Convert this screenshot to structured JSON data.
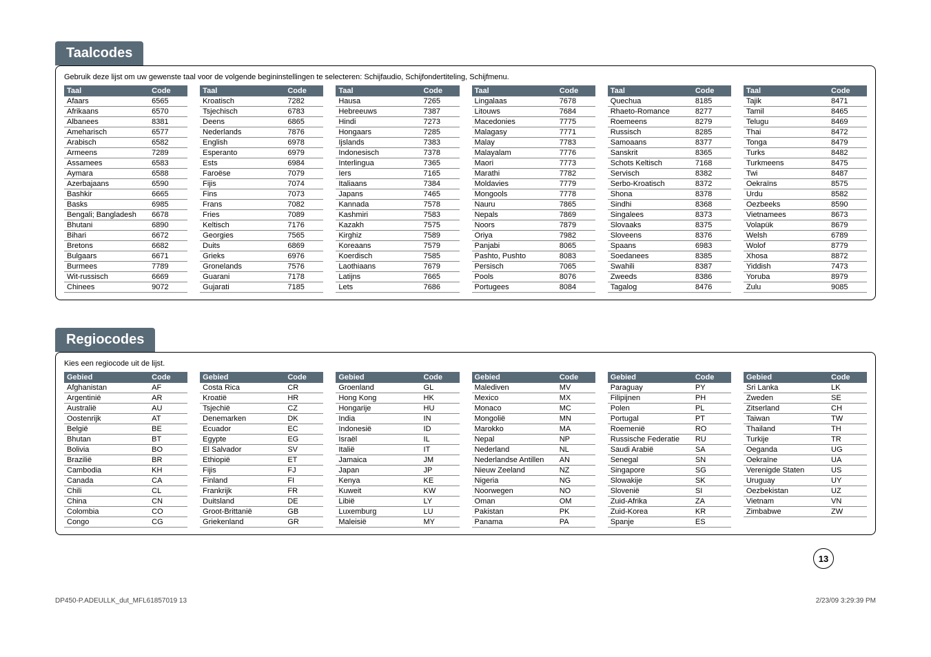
{
  "sections": {
    "taal": {
      "title": "Taalcodes",
      "intro": "Gebruik deze lijst om uw gewenste taal voor de volgende begininstellingen te selecteren: Schijfaudio, Schijfondertiteling, Schijfmenu.",
      "headers": {
        "name": "Taal",
        "code": "Code"
      },
      "columns": [
        [
          {
            "n": "Afaars",
            "c": "6565"
          },
          {
            "n": "Afrikaans",
            "c": "6570"
          },
          {
            "n": "Albanees",
            "c": "8381"
          },
          {
            "n": "Ameharisch",
            "c": "6577"
          },
          {
            "n": "Arabisch",
            "c": "6582"
          },
          {
            "n": "Armeens",
            "c": "7289"
          },
          {
            "n": "Assamees",
            "c": "6583"
          },
          {
            "n": "Aymara",
            "c": "6588"
          },
          {
            "n": "Azerbajaans",
            "c": "6590"
          },
          {
            "n": "Bashkir",
            "c": "6665"
          },
          {
            "n": "Basks",
            "c": "6985"
          },
          {
            "n": "Bengali; Bangladesh",
            "c": "6678"
          },
          {
            "n": "Bhutani",
            "c": "6890"
          },
          {
            "n": "Bihari",
            "c": "6672"
          },
          {
            "n": "Bretons",
            "c": "6682"
          },
          {
            "n": "Bulgaars",
            "c": "6671"
          },
          {
            "n": "Burmees",
            "c": "7789"
          },
          {
            "n": "Wit-russisch",
            "c": "6669"
          },
          {
            "n": "Chinees",
            "c": "9072"
          }
        ],
        [
          {
            "n": "Kroatisch",
            "c": "7282"
          },
          {
            "n": "Tsjechisch",
            "c": "6783"
          },
          {
            "n": "Deens",
            "c": "6865"
          },
          {
            "n": "Nederlands",
            "c": "7876"
          },
          {
            "n": "English",
            "c": "6978"
          },
          {
            "n": "Esperanto",
            "c": "6979"
          },
          {
            "n": "Ests",
            "c": "6984"
          },
          {
            "n": "Faroëse",
            "c": "7079"
          },
          {
            "n": "Fijis",
            "c": "7074"
          },
          {
            "n": "Fins",
            "c": "7073"
          },
          {
            "n": "Frans",
            "c": "7082"
          },
          {
            "n": "Fries",
            "c": "7089"
          },
          {
            "n": "Keltisch",
            "c": "7176"
          },
          {
            "n": "Georgies",
            "c": "7565"
          },
          {
            "n": "Duits",
            "c": "6869"
          },
          {
            "n": "Grieks",
            "c": "6976"
          },
          {
            "n": "Gronelands",
            "c": "7576"
          },
          {
            "n": "Guarani",
            "c": "7178"
          },
          {
            "n": "Gujarati",
            "c": "7185"
          }
        ],
        [
          {
            "n": "Hausa",
            "c": "7265"
          },
          {
            "n": "Hebreeuws",
            "c": "7387"
          },
          {
            "n": "Hindi",
            "c": "7273"
          },
          {
            "n": "Hongaars",
            "c": "7285"
          },
          {
            "n": "Ijslands",
            "c": "7383"
          },
          {
            "n": "Indonesisch",
            "c": "7378"
          },
          {
            "n": "Interlingua",
            "c": "7365"
          },
          {
            "n": "Iers",
            "c": "7165"
          },
          {
            "n": "Italiaans",
            "c": "7384"
          },
          {
            "n": "Japans",
            "c": "7465"
          },
          {
            "n": "Kannada",
            "c": "7578"
          },
          {
            "n": "Kashmiri",
            "c": "7583"
          },
          {
            "n": "Kazakh",
            "c": "7575"
          },
          {
            "n": "Kirghiz",
            "c": "7589"
          },
          {
            "n": "Koreaans",
            "c": "7579"
          },
          {
            "n": "Koerdisch",
            "c": "7585"
          },
          {
            "n": "Laothiaans",
            "c": "7679"
          },
          {
            "n": "Latijns",
            "c": "7665"
          },
          {
            "n": "Lets",
            "c": "7686"
          }
        ],
        [
          {
            "n": "Lingalaas",
            "c": "7678"
          },
          {
            "n": "Litouws",
            "c": "7684"
          },
          {
            "n": "Macedonies",
            "c": "7775"
          },
          {
            "n": "Malagasy",
            "c": "7771"
          },
          {
            "n": "Malay",
            "c": "7783"
          },
          {
            "n": "Malayalam",
            "c": "7776"
          },
          {
            "n": "Maori",
            "c": "7773"
          },
          {
            "n": "Marathi",
            "c": "7782"
          },
          {
            "n": "Moldavies",
            "c": "7779"
          },
          {
            "n": "Mongools",
            "c": "7778"
          },
          {
            "n": "Nauru",
            "c": "7865"
          },
          {
            "n": "Nepals",
            "c": "7869"
          },
          {
            "n": "Noors",
            "c": "7879"
          },
          {
            "n": "Oriya",
            "c": "7982"
          },
          {
            "n": "Panjabi",
            "c": "8065"
          },
          {
            "n": "Pashto, Pushto",
            "c": "8083"
          },
          {
            "n": "Persisch",
            "c": "7065"
          },
          {
            "n": "Pools",
            "c": "8076"
          },
          {
            "n": "Portugees",
            "c": "8084"
          }
        ],
        [
          {
            "n": "Quechua",
            "c": "8185"
          },
          {
            "n": "Rhaeto-Romance",
            "c": "8277"
          },
          {
            "n": "Roemeens",
            "c": "8279"
          },
          {
            "n": "Russisch",
            "c": "8285"
          },
          {
            "n": "Samoaans",
            "c": "8377"
          },
          {
            "n": "Sanskrit",
            "c": "8365"
          },
          {
            "n": "Schots Keltisch",
            "c": "7168"
          },
          {
            "n": "Servisch",
            "c": "8382"
          },
          {
            "n": "Serbo-Kroatisch",
            "c": "8372"
          },
          {
            "n": "Shona",
            "c": "8378"
          },
          {
            "n": "Sindhi",
            "c": "8368"
          },
          {
            "n": "Singalees",
            "c": "8373"
          },
          {
            "n": "Slovaaks",
            "c": "8375"
          },
          {
            "n": "Sloveens",
            "c": "8376"
          },
          {
            "n": "Spaans",
            "c": "6983"
          },
          {
            "n": "Soedanees",
            "c": "8385"
          },
          {
            "n": "Swahili",
            "c": "8387"
          },
          {
            "n": "Zweeds",
            "c": "8386"
          },
          {
            "n": "Tagalog",
            "c": "8476"
          }
        ],
        [
          {
            "n": "Tajik",
            "c": "8471"
          },
          {
            "n": "Tamil",
            "c": "8465"
          },
          {
            "n": "Telugu",
            "c": "8469"
          },
          {
            "n": "Thai",
            "c": "8472"
          },
          {
            "n": "Tonga",
            "c": "8479"
          },
          {
            "n": "Turks",
            "c": "8482"
          },
          {
            "n": "Turkmeens",
            "c": "8475"
          },
          {
            "n": "Twi",
            "c": "8487"
          },
          {
            "n": "Oekraïns",
            "c": "8575"
          },
          {
            "n": "Urdu",
            "c": "8582"
          },
          {
            "n": "Oezbeeks",
            "c": "8590"
          },
          {
            "n": "Vietnamees",
            "c": "8673"
          },
          {
            "n": "Volapük",
            "c": "8679"
          },
          {
            "n": "Welsh",
            "c": "6789"
          },
          {
            "n": "Wolof",
            "c": "8779"
          },
          {
            "n": "Xhosa",
            "c": "8872"
          },
          {
            "n": "Yiddish",
            "c": "7473"
          },
          {
            "n": "Yoruba",
            "c": "8979"
          },
          {
            "n": "Zulu",
            "c": "9085"
          }
        ]
      ]
    },
    "regio": {
      "title": "Regiocodes",
      "intro": "Kies een regiocode uit de lijst.",
      "headers": {
        "name": "Gebied",
        "code": "Code"
      },
      "columns": [
        [
          {
            "n": "Afghanistan",
            "c": "AF"
          },
          {
            "n": "Argentinië",
            "c": "AR"
          },
          {
            "n": "Australië",
            "c": "AU"
          },
          {
            "n": "Oostenrijk",
            "c": "AT"
          },
          {
            "n": "België",
            "c": "BE"
          },
          {
            "n": "Bhutan",
            "c": "BT"
          },
          {
            "n": "Bolivia",
            "c": "BO"
          },
          {
            "n": "Brazilië",
            "c": "BR"
          },
          {
            "n": "Cambodia",
            "c": "KH"
          },
          {
            "n": "Canada",
            "c": "CA"
          },
          {
            "n": "Chili",
            "c": "CL"
          },
          {
            "n": "China",
            "c": "CN"
          },
          {
            "n": "Colombia",
            "c": "CO"
          },
          {
            "n": "Congo",
            "c": "CG"
          }
        ],
        [
          {
            "n": "Costa Rica",
            "c": "CR"
          },
          {
            "n": "Kroatië",
            "c": "HR"
          },
          {
            "n": "Tsjechië",
            "c": "CZ"
          },
          {
            "n": "Denemarken",
            "c": "DK"
          },
          {
            "n": "Ecuador",
            "c": "EC"
          },
          {
            "n": "Egypte",
            "c": "EG"
          },
          {
            "n": "El Salvador",
            "c": "SV"
          },
          {
            "n": "Ethiopië",
            "c": "ET"
          },
          {
            "n": "Fijis",
            "c": "FJ"
          },
          {
            "n": "Finland",
            "c": "FI"
          },
          {
            "n": "Frankrijk",
            "c": "FR"
          },
          {
            "n": "Duitsland",
            "c": "DE"
          },
          {
            "n": "Groot-Brittanië",
            "c": "GB"
          },
          {
            "n": "Griekenland",
            "c": "GR"
          }
        ],
        [
          {
            "n": "Groenland",
            "c": "GL"
          },
          {
            "n": "Hong Kong",
            "c": "HK"
          },
          {
            "n": "Hongarije",
            "c": "HU"
          },
          {
            "n": "India",
            "c": "IN"
          },
          {
            "n": "Indonesië",
            "c": "ID"
          },
          {
            "n": "Israël",
            "c": "IL"
          },
          {
            "n": "Italië",
            "c": "IT"
          },
          {
            "n": "Jamaica",
            "c": "JM"
          },
          {
            "n": "Japan",
            "c": "JP"
          },
          {
            "n": "Kenya",
            "c": "KE"
          },
          {
            "n": "Kuweit",
            "c": "KW"
          },
          {
            "n": "Libië",
            "c": "LY"
          },
          {
            "n": "Luxemburg",
            "c": "LU"
          },
          {
            "n": "Maleisië",
            "c": "MY"
          }
        ],
        [
          {
            "n": "Malediven",
            "c": "MV"
          },
          {
            "n": "Mexico",
            "c": "MX"
          },
          {
            "n": "Monaco",
            "c": "MC"
          },
          {
            "n": "Mongolië",
            "c": "MN"
          },
          {
            "n": "Marokko",
            "c": "MA"
          },
          {
            "n": "Nepal",
            "c": "NP"
          },
          {
            "n": "Nederland",
            "c": "NL"
          },
          {
            "n": "Nederlandse Antillen",
            "c": "AN"
          },
          {
            "n": "Nieuw Zeeland",
            "c": "NZ"
          },
          {
            "n": "Nigeria",
            "c": "NG"
          },
          {
            "n": "Noorwegen",
            "c": "NO"
          },
          {
            "n": "Oman",
            "c": "OM"
          },
          {
            "n": "Pakistan",
            "c": "PK"
          },
          {
            "n": "Panama",
            "c": "PA"
          }
        ],
        [
          {
            "n": "Paraguay",
            "c": "PY"
          },
          {
            "n": "Filipijnen",
            "c": "PH"
          },
          {
            "n": "Polen",
            "c": "PL"
          },
          {
            "n": "Portugal",
            "c": "PT"
          },
          {
            "n": "Roemenië",
            "c": "RO"
          },
          {
            "n": "Russische Federatie",
            "c": "RU"
          },
          {
            "n": "Saudi Arabië",
            "c": "SA"
          },
          {
            "n": "Senegal",
            "c": "SN"
          },
          {
            "n": "Singapore",
            "c": "SG"
          },
          {
            "n": "Slowakije",
            "c": "SK"
          },
          {
            "n": "Slovenië",
            "c": "SI"
          },
          {
            "n": "Zuid-Afrika",
            "c": "ZA"
          },
          {
            "n": "Zuid-Korea",
            "c": "KR"
          },
          {
            "n": "Spanje",
            "c": "ES"
          }
        ],
        [
          {
            "n": "Sri Lanka",
            "c": "LK"
          },
          {
            "n": "Zweden",
            "c": "SE"
          },
          {
            "n": "Zitserland",
            "c": "CH"
          },
          {
            "n": "Taiwan",
            "c": "TW"
          },
          {
            "n": "Thailand",
            "c": "TH"
          },
          {
            "n": "Turkije",
            "c": "TR"
          },
          {
            "n": "Oeganda",
            "c": "UG"
          },
          {
            "n": "Oekraïne",
            "c": "UA"
          },
          {
            "n": "Verenigde Staten",
            "c": "US"
          },
          {
            "n": "Uruguay",
            "c": "UY"
          },
          {
            "n": "Oezbekistan",
            "c": "UZ"
          },
          {
            "n": "Vietnam",
            "c": "VN"
          },
          {
            "n": "Zimbabwe",
            "c": "ZW"
          }
        ]
      ]
    }
  },
  "page_number": "13",
  "footer": {
    "left": "DP450-P.ADEULLK_dut_MFL61857019   13",
    "right": "2/23/09   3:29:39 PM"
  }
}
